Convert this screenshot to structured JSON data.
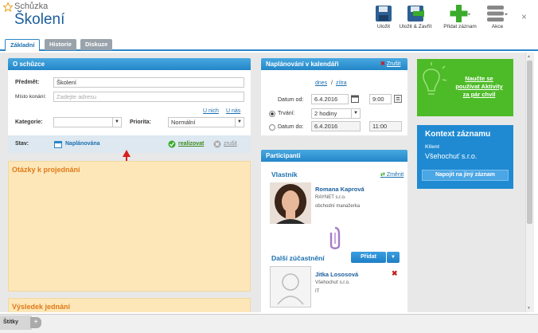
{
  "window": {
    "title": "Schůzka",
    "record_title": "Školení",
    "close": "×"
  },
  "toolbar": {
    "save": "Uložit",
    "save_close": "Uložit & Zavřít",
    "add_record": "Přidat záznam",
    "actions": "Akce"
  },
  "tabs": [
    "Základní",
    "Historie",
    "Diskuze"
  ],
  "o_schuzce": {
    "header": "O schůzce",
    "subject_label": "Předmět:",
    "subject_value": "Školení",
    "place_label": "Místo konání:",
    "place_placeholder": "Zadejte adresu",
    "link_u_nich": "U nich",
    "link_u_nas": "U nás",
    "category_label": "Kategorie:",
    "category_value": "",
    "priority_label": "Priorita:",
    "priority_value": "Normální",
    "state_label": "Stav:",
    "state_value": "Naplánována",
    "realize": "realizovat",
    "cancel": "zrušit"
  },
  "notes": {
    "questions": "Otázky k projednání",
    "result": "Výsledek jednání"
  },
  "calendar": {
    "header": "Naplánování v kalendáři",
    "cancel": "Zrušit",
    "today": "dnes",
    "slash": "/",
    "tomorrow": "zítra",
    "date_from_label": "Datum od:",
    "date_from": "6.4.2016",
    "time_from": "9:00",
    "duration_label": "Trvání:",
    "duration_value": "2 hodiny",
    "date_to_label": "Datum do:",
    "date_to": "6.4.2016",
    "time_to": "11:00"
  },
  "participants": {
    "header": "Participanti",
    "owner_label": "Vlastník",
    "change": "Změnit",
    "owner_name": "Romana Kaprová",
    "owner_company": "RAYNET s.r.o.",
    "owner_role": "obchodní manažerka",
    "others_label": "Další zúčastnění",
    "add_button": "Přidat",
    "p2_name": "Jitka Lososová",
    "p2_company": "Všehochuť s.r.o.",
    "p2_role": "IT"
  },
  "promo": {
    "line1": "Naučte se",
    "line2": "používat Aktivity",
    "line3": "za pár chvil"
  },
  "context": {
    "title": "Kontext záznamu",
    "client_label": "Klient",
    "client_name": "Všehochuť s.r.o.",
    "link_button": "Napojit na jiný záznam"
  },
  "footer": {
    "tab": "Štítky",
    "plus": "+"
  },
  "colors": {
    "accent": "#2386c8",
    "title": "#1a5e9c",
    "note": "#fde7b8",
    "promo": "#4dbb28",
    "green": "#3aab2a"
  }
}
